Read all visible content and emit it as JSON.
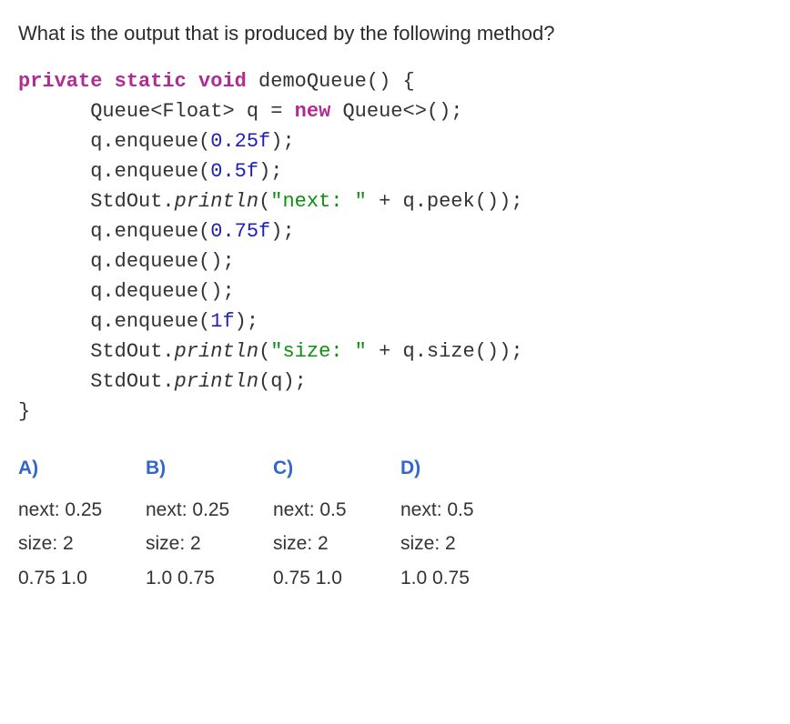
{
  "question": "What is the output that is produced by the following method?",
  "code": {
    "line1_kw1": "private",
    "line1_kw2": "static",
    "line1_kw3": "void",
    "line1_method": " demoQueue() {",
    "line2_gentype": "Queue<Float>",
    "line2_var": " q ",
    "line2_eq": "= ",
    "line2_kw": "new",
    "line2_rest": " Queue<>();",
    "line3_pre": "q.enqueue(",
    "line3_num": "0.25f",
    "line3_post": ");",
    "line4_pre": "q.enqueue(",
    "line4_num": "0.5f",
    "line4_post": ");",
    "line5_pre": "StdOut.",
    "line5_call": "println",
    "line5_open": "(",
    "line5_str": "\"next: \"",
    "line5_post": " + q.peek());",
    "line6_pre": "q.enqueue(",
    "line6_num": "0.75f",
    "line6_post": ");",
    "line7": "q.dequeue();",
    "line8": "q.dequeue();",
    "line9_pre": "q.enqueue(",
    "line9_num": "1f",
    "line9_post": ");",
    "line10_pre": "StdOut.",
    "line10_call": "println",
    "line10_open": "(",
    "line10_str": "\"size: \"",
    "line10_post": " + q.size());",
    "line11_pre": "StdOut.",
    "line11_call": "println",
    "line11_post": "(q);",
    "line12": "}"
  },
  "options": {
    "a": "A)",
    "b": "B)",
    "c": "C)",
    "d": "D)"
  },
  "answers": {
    "row1": {
      "a": "next: 0.25",
      "b": "next: 0.25",
      "c": "next: 0.5",
      "d": "next: 0.5"
    },
    "row2": {
      "a": "size: 2",
      "b": "size: 2",
      "c": "size: 2",
      "d": "size: 2"
    },
    "row3": {
      "a": "0.75  1.0",
      "b": "1.0  0.75",
      "c": "0.75  1.0",
      "d": "1.0  0.75"
    }
  }
}
